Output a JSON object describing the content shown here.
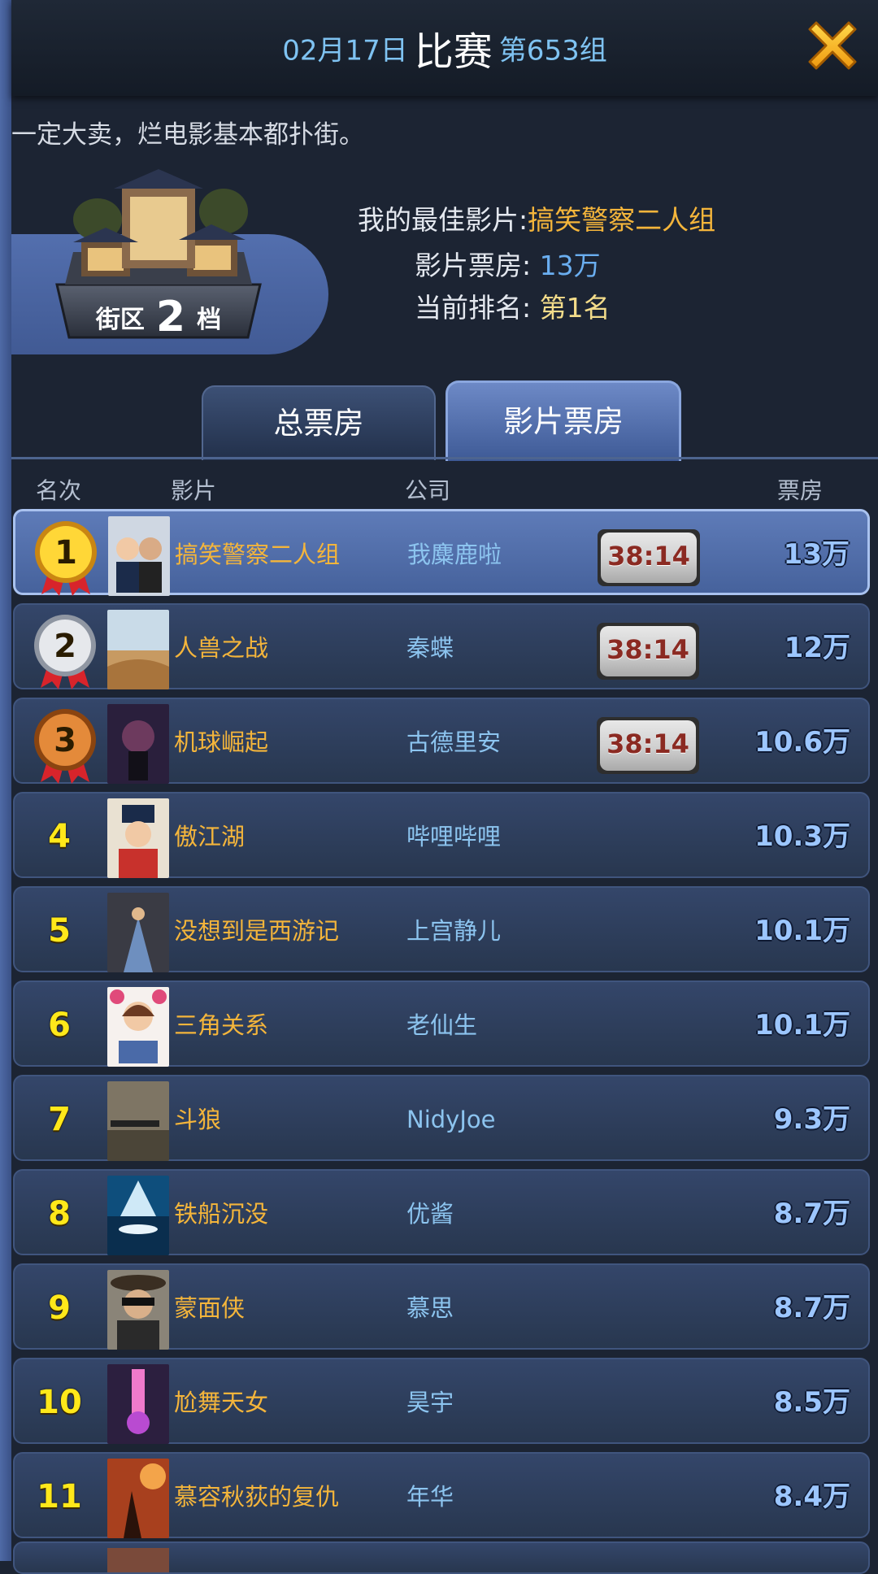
{
  "header": {
    "date": "02月17日",
    "title": "比赛",
    "group": "第653组"
  },
  "description": "一定大卖，烂电影基本都扑街。",
  "district": {
    "prefix": "街区",
    "level": "2",
    "suffix": "档"
  },
  "best": {
    "best_label": "我的最佳影片:",
    "best_value": "搞笑警察二人组",
    "boxoffice_label": "影片票房:",
    "boxoffice_value": "13万",
    "rank_label": "当前排名:",
    "rank_value": "第1名"
  },
  "tabs": [
    {
      "label": "总票房",
      "active": false
    },
    {
      "label": "影片票房",
      "active": true
    }
  ],
  "columns": {
    "rank": "名次",
    "film": "影片",
    "company": "公司",
    "boxoffice": "票房"
  },
  "rows": [
    {
      "rank": "1",
      "film": "搞笑警察二人组",
      "company": "我麋鹿啦",
      "timer": "38:14",
      "boxoffice": "13万"
    },
    {
      "rank": "2",
      "film": "人兽之战",
      "company": "秦蝶",
      "timer": "38:14",
      "boxoffice": "12万"
    },
    {
      "rank": "3",
      "film": "机球崛起",
      "company": "古德里安",
      "timer": "38:14",
      "boxoffice": "10.6万"
    },
    {
      "rank": "4",
      "film": "傲江湖",
      "company": "哔哩哔哩",
      "boxoffice": "10.3万"
    },
    {
      "rank": "5",
      "film": "没想到是西游记",
      "company": "上宫静儿",
      "boxoffice": "10.1万"
    },
    {
      "rank": "6",
      "film": "三角关系",
      "company": "老仙生",
      "boxoffice": "10.1万"
    },
    {
      "rank": "7",
      "film": "斗狼",
      "company": "NidyJoe",
      "boxoffice": "9.3万"
    },
    {
      "rank": "8",
      "film": "铁船沉没",
      "company": "优酱",
      "boxoffice": "8.7万"
    },
    {
      "rank": "9",
      "film": "蒙面侠",
      "company": "慕思",
      "boxoffice": "8.7万"
    },
    {
      "rank": "10",
      "film": "尬舞天女",
      "company": "昊宇",
      "boxoffice": "8.5万"
    },
    {
      "rank": "11",
      "film": "慕容秋荻的复仇",
      "company": "年华",
      "boxoffice": "8.4万"
    }
  ],
  "colors": {
    "accent_orange": "#f4b53b",
    "accent_blue": "#7fc3f2",
    "rank_yellow": "#ffe81a",
    "background": "#1c2433"
  },
  "icons": {
    "close": "close-x-icon",
    "medal_gold": "gold-medal-icon",
    "medal_silver": "silver-medal-icon",
    "medal_bronze": "bronze-medal-icon",
    "building": "cinema-building-icon"
  }
}
